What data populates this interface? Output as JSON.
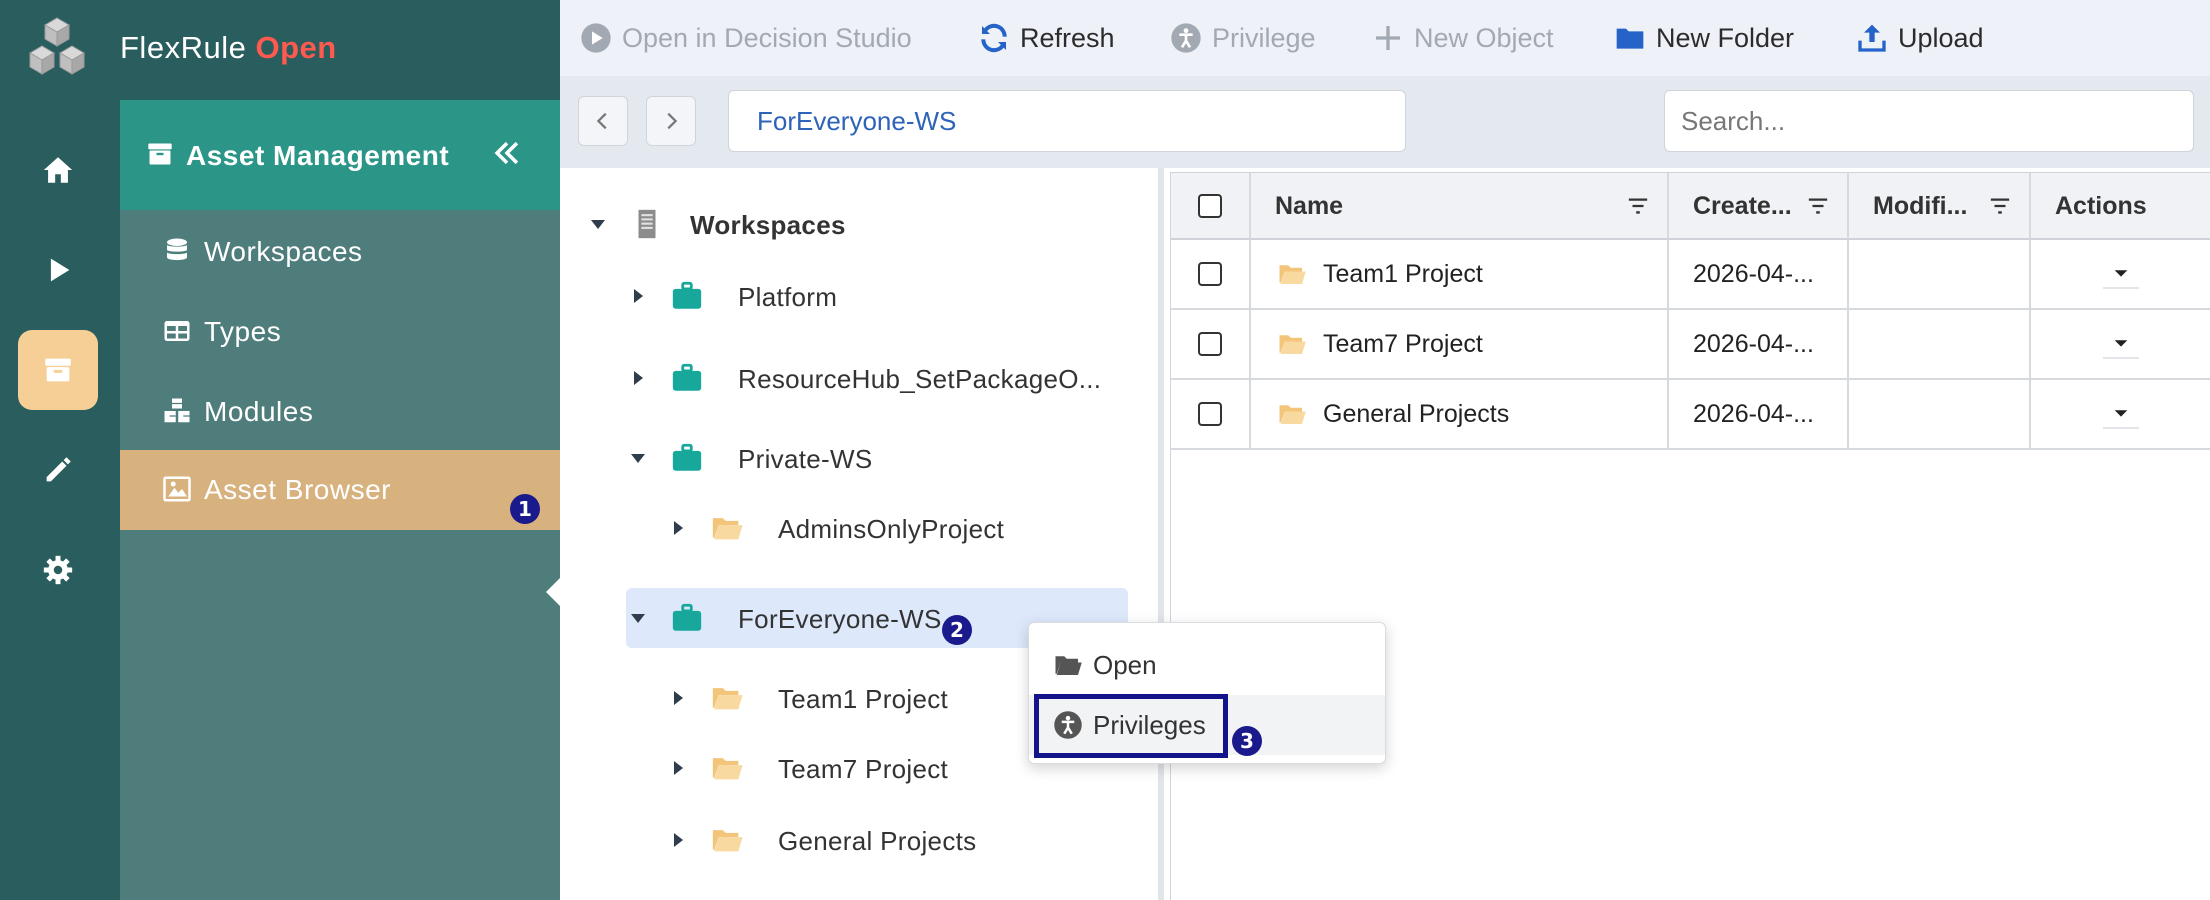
{
  "brand": {
    "name": "FlexRule",
    "accent": "Open",
    "accent_color": "#ff5a4f"
  },
  "rail": {
    "items": [
      {
        "icon": "home-icon"
      },
      {
        "icon": "play-icon"
      },
      {
        "icon": "archive-icon",
        "active": true
      },
      {
        "icon": "pencil-icon"
      },
      {
        "icon": "gear-icon"
      }
    ]
  },
  "asset_panel": {
    "title": "Asset Management",
    "items": [
      {
        "label": "Workspaces",
        "icon": "database-icon"
      },
      {
        "label": "Types",
        "icon": "table-icon"
      },
      {
        "label": "Modules",
        "icon": "cubes-icon"
      },
      {
        "label": "Asset Browser",
        "icon": "image-icon",
        "active": true
      }
    ]
  },
  "toolbar": {
    "open_studio": "Open in Decision Studio",
    "refresh": "Refresh",
    "privilege": "Privilege",
    "new_object": "New Object",
    "new_folder": "New Folder",
    "upload": "Upload"
  },
  "address": {
    "path": "ForEveryone-WS",
    "search_placeholder": "Search..."
  },
  "tree": {
    "root": "Workspaces",
    "nodes": [
      {
        "label": "Platform"
      },
      {
        "label": "ResourceHub_SetPackageO..."
      },
      {
        "label": "Private-WS"
      },
      {
        "label": "AdminsOnlyProject"
      },
      {
        "label": "ForEveryone-WS",
        "selected": true
      },
      {
        "label": "Team1 Project"
      },
      {
        "label": "Team7 Project"
      },
      {
        "label": "General Projects"
      }
    ]
  },
  "grid": {
    "columns": {
      "name": "Name",
      "created": "Create...",
      "modified": "Modifi...",
      "actions": "Actions"
    },
    "rows": [
      {
        "name": "Team1 Project",
        "created": "2026-04-..."
      },
      {
        "name": "Team7 Project",
        "created": "2026-04-..."
      },
      {
        "name": "General Projects",
        "created": "2026-04-..."
      }
    ]
  },
  "context_menu": {
    "open": "Open",
    "privileges": "Privileges"
  },
  "badges": {
    "one": "1",
    "two": "2",
    "three": "3"
  },
  "colors": {
    "rail": "#2a5d5d",
    "panel": "#4f7d7c",
    "panel_header": "#2b9588",
    "active_item": "#d7b27e",
    "annotation": "#14148a"
  }
}
